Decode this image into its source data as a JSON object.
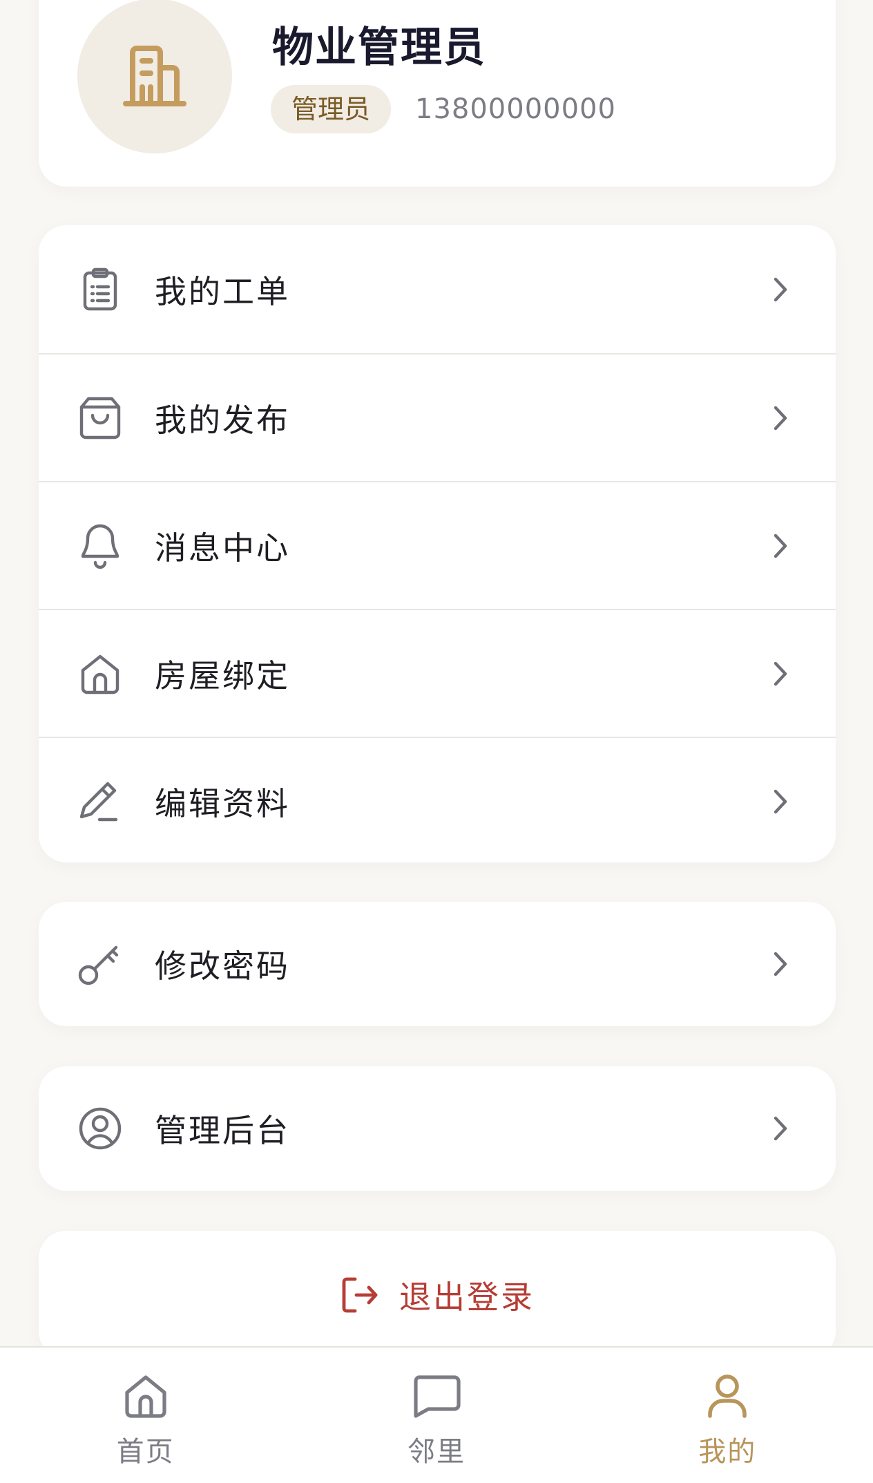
{
  "colors": {
    "accent": "#b8955a",
    "danger": "#b63d35",
    "icon": "#6f6f78",
    "background": "#f8f7f4"
  },
  "profile": {
    "avatar_icon": "building-icon",
    "name": "物业管理员",
    "role": "管理员",
    "phone": "13800000000"
  },
  "menu_group_1": [
    {
      "label": "我的工单",
      "icon": "clipboard-list-icon"
    },
    {
      "label": "我的发布",
      "icon": "shopping-bag-icon"
    },
    {
      "label": "消息中心",
      "icon": "bell-icon"
    },
    {
      "label": "房屋绑定",
      "icon": "home-icon"
    },
    {
      "label": "编辑资料",
      "icon": "pencil-icon"
    }
  ],
  "menu_group_2": [
    {
      "label": "修改密码",
      "icon": "key-icon"
    }
  ],
  "menu_group_3": [
    {
      "label": "管理后台",
      "icon": "user-circle-icon"
    }
  ],
  "logout": {
    "label": "退出登录",
    "icon": "logout-icon"
  },
  "tabbar": [
    {
      "label": "首页",
      "icon": "home-icon",
      "active": false
    },
    {
      "label": "邻里",
      "icon": "chat-bubble-icon",
      "active": false
    },
    {
      "label": "我的",
      "icon": "user-icon",
      "active": true
    }
  ]
}
